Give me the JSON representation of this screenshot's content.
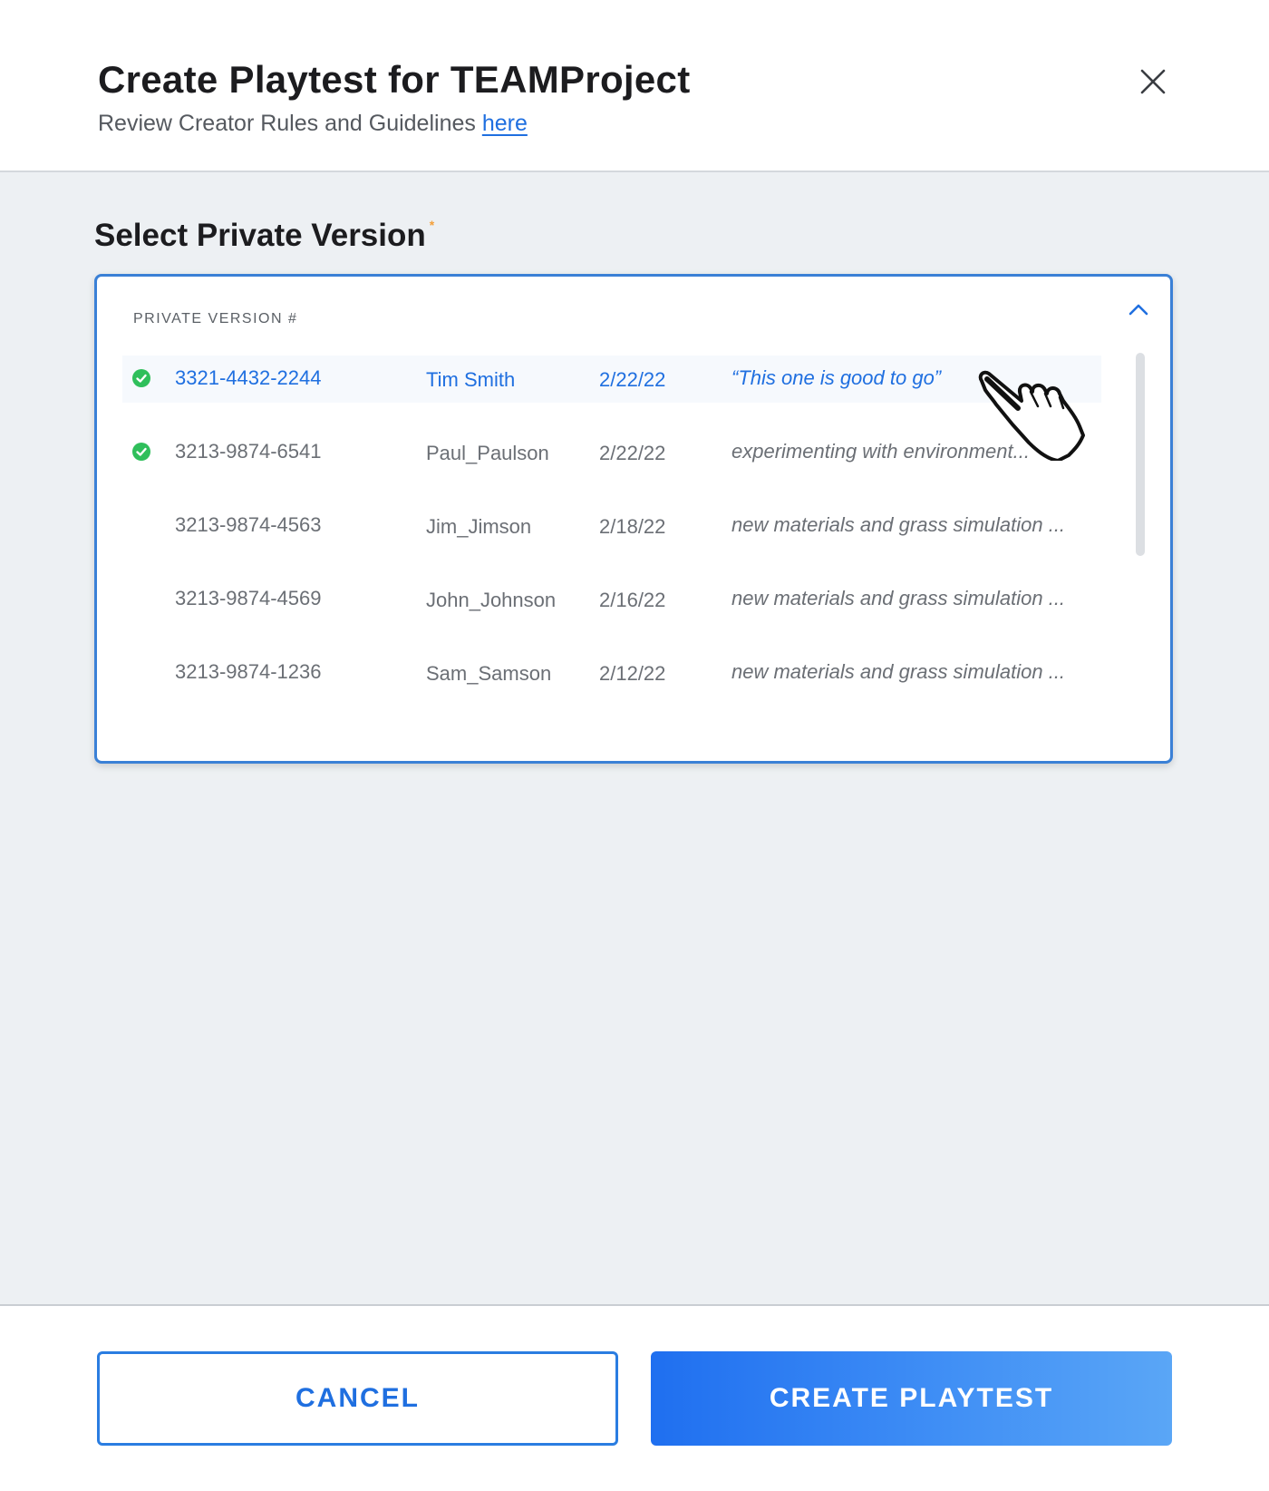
{
  "header": {
    "title": "Create Playtest for TEAMProject",
    "subtitle_text": "Review Creator Rules and Guidelines ",
    "subtitle_link": "here",
    "close_icon": "close-icon"
  },
  "section": {
    "label": "Select Private Version",
    "required_marker": "*"
  },
  "dropdown": {
    "column_label": "PRIVATE VERSION #",
    "toggle_icon": "chevron-up-icon",
    "rows": [
      {
        "id": "3321-4432-2244",
        "author": "Tim Smith",
        "date": "2/22/22",
        "note": "“This one is good to go”",
        "verified": true,
        "selected": true
      },
      {
        "id": "3213-9874-6541",
        "author": "Paul_Paulson",
        "date": "2/22/22",
        "note": "experimenting with environment...",
        "verified": true,
        "selected": false
      },
      {
        "id": "3213-9874-4563",
        "author": "Jim_Jimson",
        "date": "2/18/22",
        "note": "new materials and grass simulation ...",
        "verified": false,
        "selected": false
      },
      {
        "id": "3213-9874-4569",
        "author": "John_Johnson",
        "date": "2/16/22",
        "note": "new materials and grass simulation ...",
        "verified": false,
        "selected": false
      },
      {
        "id": "3213-9874-1236",
        "author": "Sam_Samson",
        "date": "2/12/22",
        "note": "new materials and grass simulation ...",
        "verified": false,
        "selected": false
      }
    ]
  },
  "footer": {
    "cancel_label": "CANCEL",
    "create_label": "CREATE PLAYTEST"
  },
  "colors": {
    "accent": "#1f6fe0",
    "check": "#2fbf5b",
    "required": "#f4a03a",
    "body_bg": "#edf0f3"
  }
}
